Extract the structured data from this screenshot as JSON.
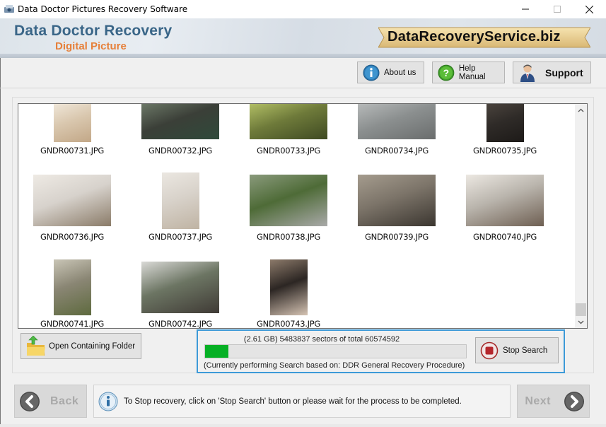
{
  "window": {
    "title": "Data Doctor Pictures Recovery Software",
    "controls": {
      "minimize": "—",
      "maximize": "☐",
      "close": "✕"
    }
  },
  "banner": {
    "title": "Data Doctor Recovery",
    "subtitle": "Digital Picture",
    "website": "DataRecoveryService.biz"
  },
  "toolbar": {
    "about_label": "About us",
    "help_label": "Help Manual",
    "support_label": "Support"
  },
  "gallery": {
    "items": [
      {
        "name": "GNDR00731.JPG",
        "colors": [
          "#d9c7ae",
          "#efe6d8",
          "#c2a787"
        ]
      },
      {
        "name": "GNDR00732.JPG",
        "colors": [
          "#3b3f38",
          "#6b7766",
          "#2f4a3a"
        ]
      },
      {
        "name": "GNDR00733.JPG",
        "colors": [
          "#6e7a3a",
          "#b0bd64",
          "#3f4a22"
        ]
      },
      {
        "name": "GNDR00734.JPG",
        "colors": [
          "#8b8f8f",
          "#b6b9b9",
          "#6a6d6d"
        ]
      },
      {
        "name": "GNDR00735.JPG",
        "colors": [
          "#2f2b28",
          "#4a433d",
          "#1d1a18"
        ]
      },
      {
        "name": "GNDR00736.JPG",
        "colors": [
          "#d7d2cc",
          "#eeeae4",
          "#8a7b68"
        ]
      },
      {
        "name": "GNDR00737.JPG",
        "colors": [
          "#d8d2ca",
          "#ebe7e1",
          "#bfb3a3"
        ]
      },
      {
        "name": "GNDR00738.JPG",
        "colors": [
          "#4e6b37",
          "#8a9a7c",
          "#a9a9a9"
        ]
      },
      {
        "name": "GNDR00739.JPG",
        "colors": [
          "#7c7469",
          "#a59c8e",
          "#3b3630"
        ]
      },
      {
        "name": "GNDR00740.JPG",
        "colors": [
          "#b9b4ac",
          "#ece8e2",
          "#6e5f52"
        ]
      },
      {
        "name": "GNDR00741.JPG",
        "colors": [
          "#8a8674",
          "#c9c5b6",
          "#5e6a3e"
        ]
      },
      {
        "name": "GNDR00742.JPG",
        "colors": [
          "#6c7563",
          "#d9d9d6",
          "#3f3a35"
        ]
      },
      {
        "name": "GNDR00743.JPG",
        "colors": [
          "#2c2623",
          "#8c7a6a",
          "#d5c3b3"
        ]
      }
    ]
  },
  "actions": {
    "open_folder_label": "Open Containing Folder"
  },
  "progress": {
    "summary": "(2.61 GB) 5483837  sectors  of  total 60574592",
    "sectors_done": 5483837,
    "sectors_total": 60574592,
    "percent": 9.05,
    "procedure": "(Currently performing Search based on:  DDR General Recovery Procedure)",
    "stop_label": "Stop Search"
  },
  "footer": {
    "back_label": "Back",
    "next_label": "Next",
    "info_message": "To Stop recovery, click on 'Stop Search' button or please wait for the process to be completed."
  },
  "colors": {
    "brand_blue": "#3a6688",
    "brand_orange": "#e6803a",
    "progress_green": "#06b025",
    "focus_blue": "#3d9ad8"
  }
}
